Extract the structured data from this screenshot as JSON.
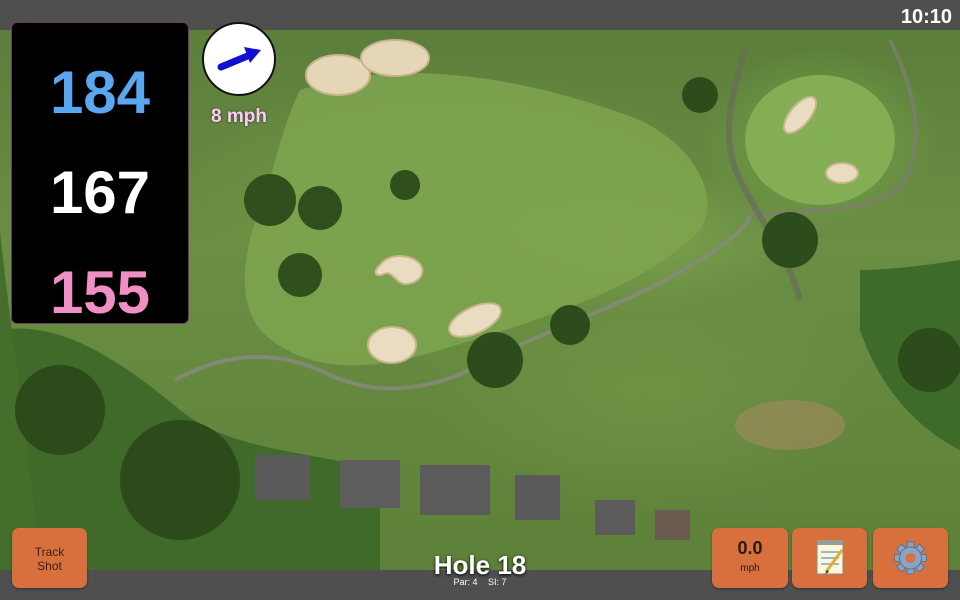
{
  "status": {
    "clock": "10:10"
  },
  "distances": {
    "back": "184",
    "middle": "167",
    "front": "155"
  },
  "wind": {
    "speed_label": "8 mph",
    "direction_icon": "arrow-icon",
    "color": "#1010d0"
  },
  "hole": {
    "title": "Hole 18",
    "par": "Par: 4",
    "si": "SI: 7"
  },
  "buttons": {
    "track_shot_line1": "Track",
    "track_shot_line2": "Shot",
    "speed_value": "0.0",
    "speed_unit": "mph",
    "notes_icon": "notepad-icon",
    "settings_icon": "gear-icon"
  },
  "colors": {
    "button_bg": "#d8703e",
    "back_distance": "#5aa7f0",
    "middle_distance": "#ffffff",
    "front_distance": "#f08fc6",
    "wind_label": "#f6d2f0"
  }
}
